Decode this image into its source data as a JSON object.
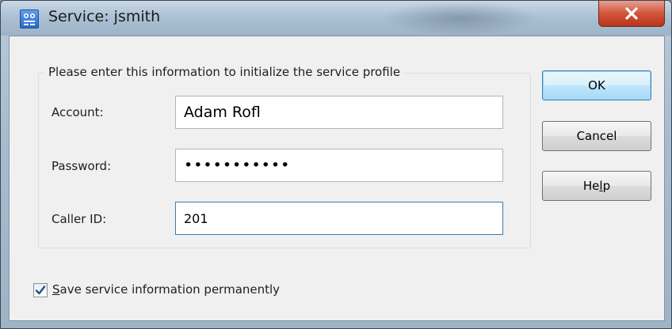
{
  "window": {
    "title": "Service: jsmith",
    "close_glyph": "X"
  },
  "group": {
    "legend": "Please enter this information to initialize the service profile"
  },
  "fields": {
    "account": {
      "label": "Account:",
      "value": "Adam Rofl"
    },
    "password": {
      "label": "Password:",
      "value": "•••••••••••"
    },
    "caller_id": {
      "label": "Caller ID:",
      "value": "201"
    }
  },
  "buttons": {
    "ok": "OK",
    "cancel": "Cancel",
    "help_prefix": "He",
    "help_mnemonic": "l",
    "help_suffix": "p"
  },
  "save_option": {
    "checked": true,
    "mnemonic": "S",
    "label_rest": "ave service information permanently"
  },
  "icons": {
    "app": "service-app-icon",
    "close": "close-icon",
    "check": "checkmark-icon"
  },
  "colors": {
    "close_button": "#c94a33",
    "default_button_border": "#3c7fb1",
    "focus_border": "#3d7bad"
  }
}
